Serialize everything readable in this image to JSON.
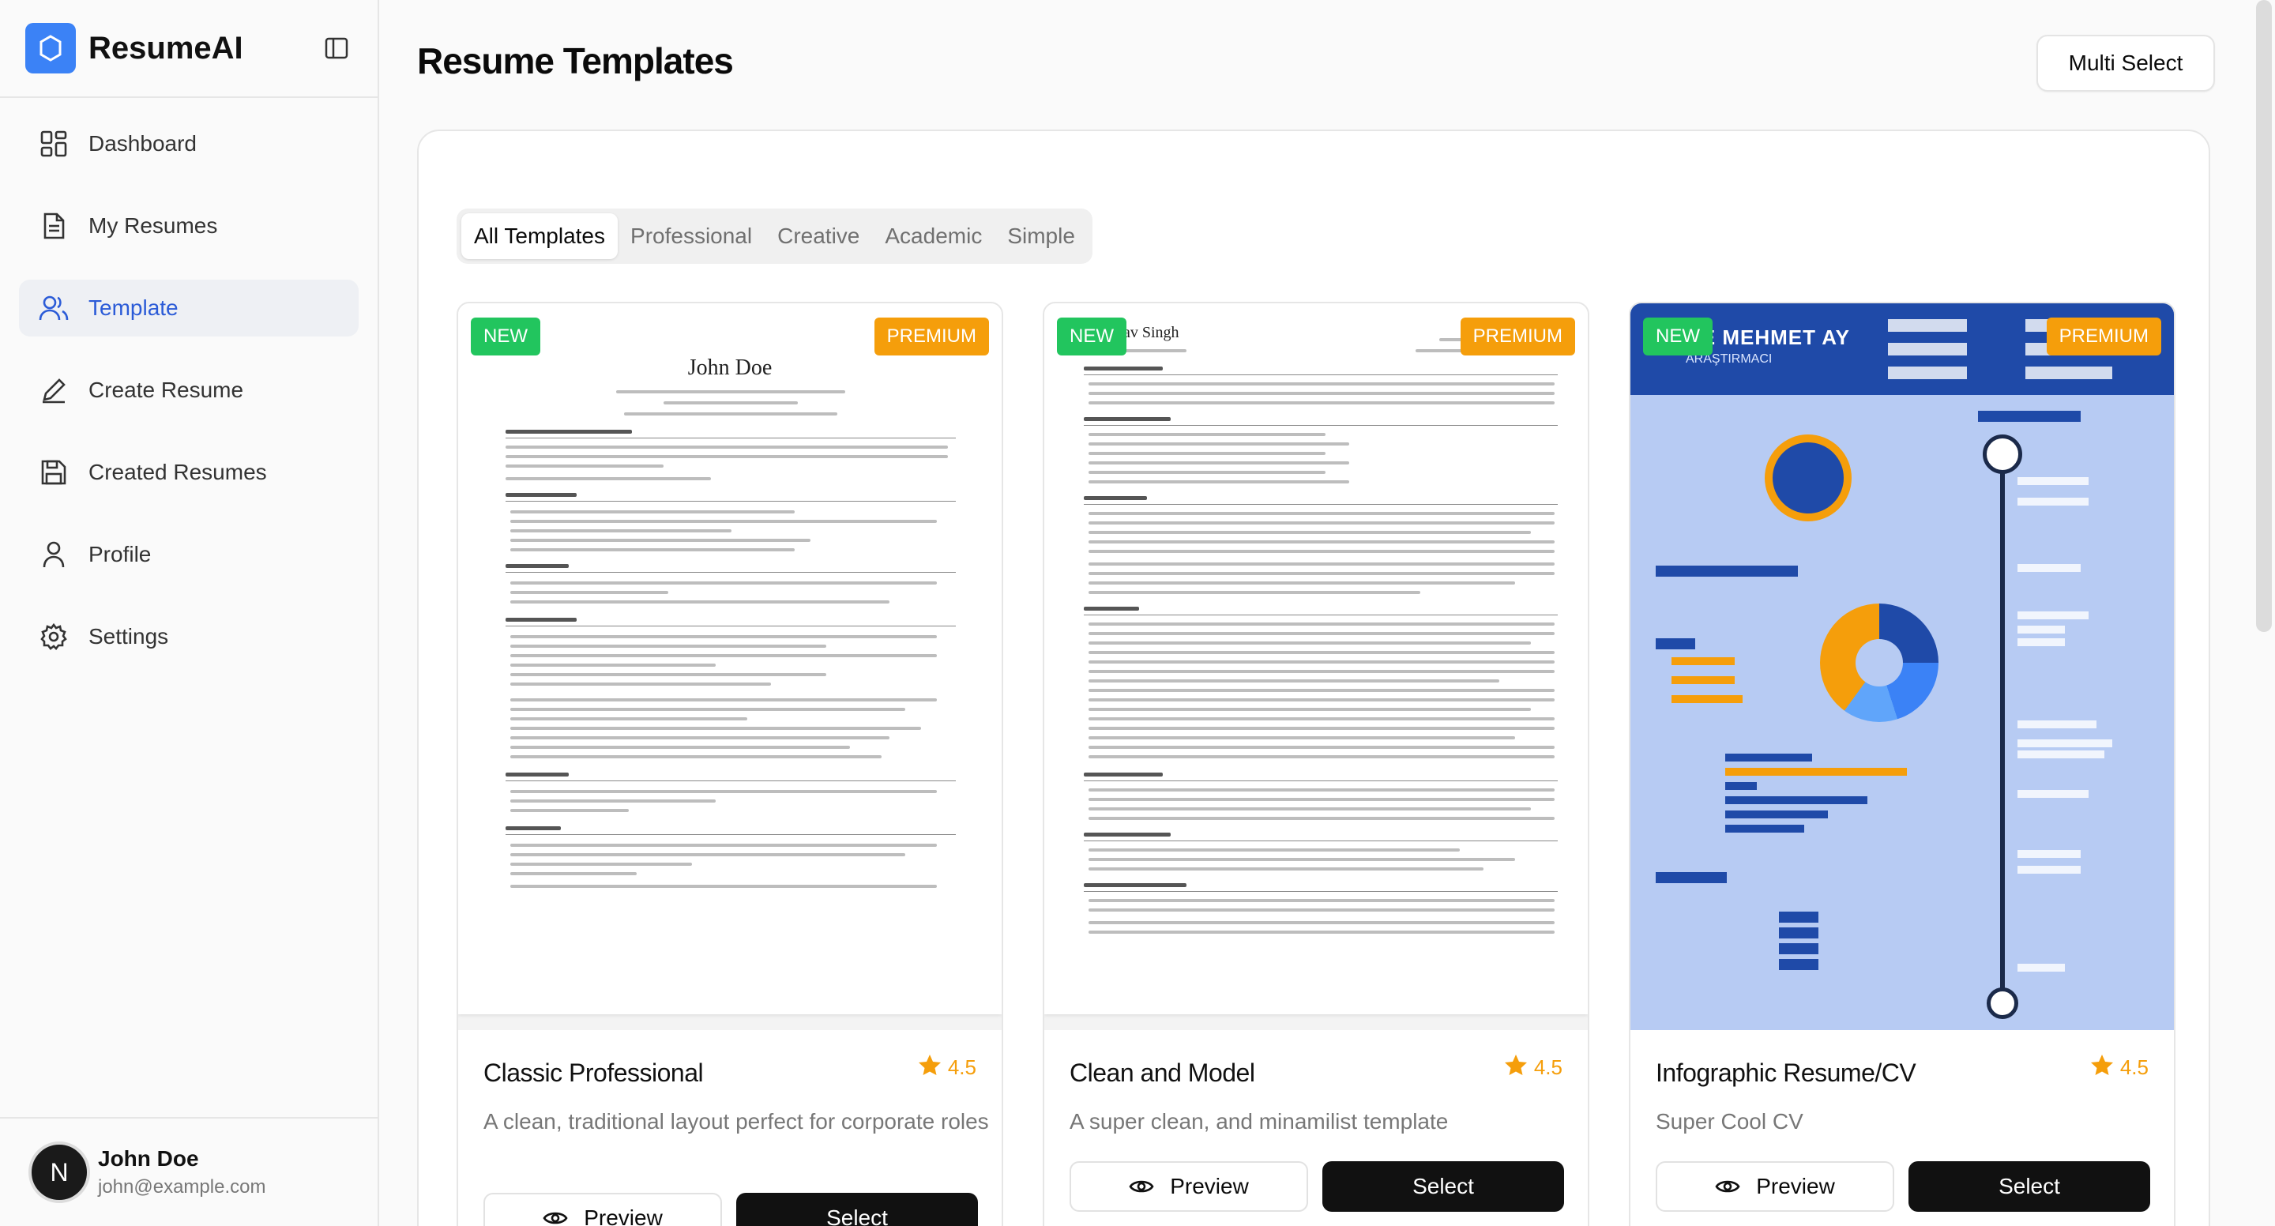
{
  "app": {
    "name": "ResumeAI"
  },
  "sidebar": {
    "items": [
      {
        "label": "Dashboard",
        "icon": "dashboard-icon"
      },
      {
        "label": "My Resumes",
        "icon": "document-icon"
      },
      {
        "label": "Template",
        "icon": "users-icon",
        "active": true
      },
      {
        "label": "Create Resume",
        "icon": "pen-icon"
      },
      {
        "label": "Created Resumes",
        "icon": "save-icon"
      },
      {
        "label": "Profile",
        "icon": "user-icon"
      },
      {
        "label": "Settings",
        "icon": "gear-icon"
      }
    ]
  },
  "user": {
    "initial": "N",
    "name": "John Doe",
    "email": "john@example.com"
  },
  "header": {
    "title": "Resume Templates",
    "multi_select": "Multi Select"
  },
  "tabs": [
    "All Templates",
    "Professional",
    "Creative",
    "Academic",
    "Simple"
  ],
  "badges": {
    "new": "NEW",
    "premium": "PREMIUM"
  },
  "buttons": {
    "preview": "Preview",
    "select": "Select"
  },
  "templates": [
    {
      "title": "Classic Professional",
      "rating": "4.5",
      "description": "A clean, traditional layout perfect for corporate roles",
      "preview_name": "John Doe"
    },
    {
      "title": "Clean and Model",
      "rating": "4.5",
      "description": "A super clean, and minamilist template",
      "preview_name": "hav Singh"
    },
    {
      "title": "Infographic Resume/CV",
      "rating": "4.5",
      "description": "Super Cool CV",
      "preview_name": "CE MEHMET AY",
      "preview_sub": "ARAŞTIRMACI"
    }
  ],
  "colors": {
    "accent": "#2b5bd7",
    "new": "#22c55e",
    "premium": "#f59e0b",
    "brand": "#3b82f6"
  }
}
